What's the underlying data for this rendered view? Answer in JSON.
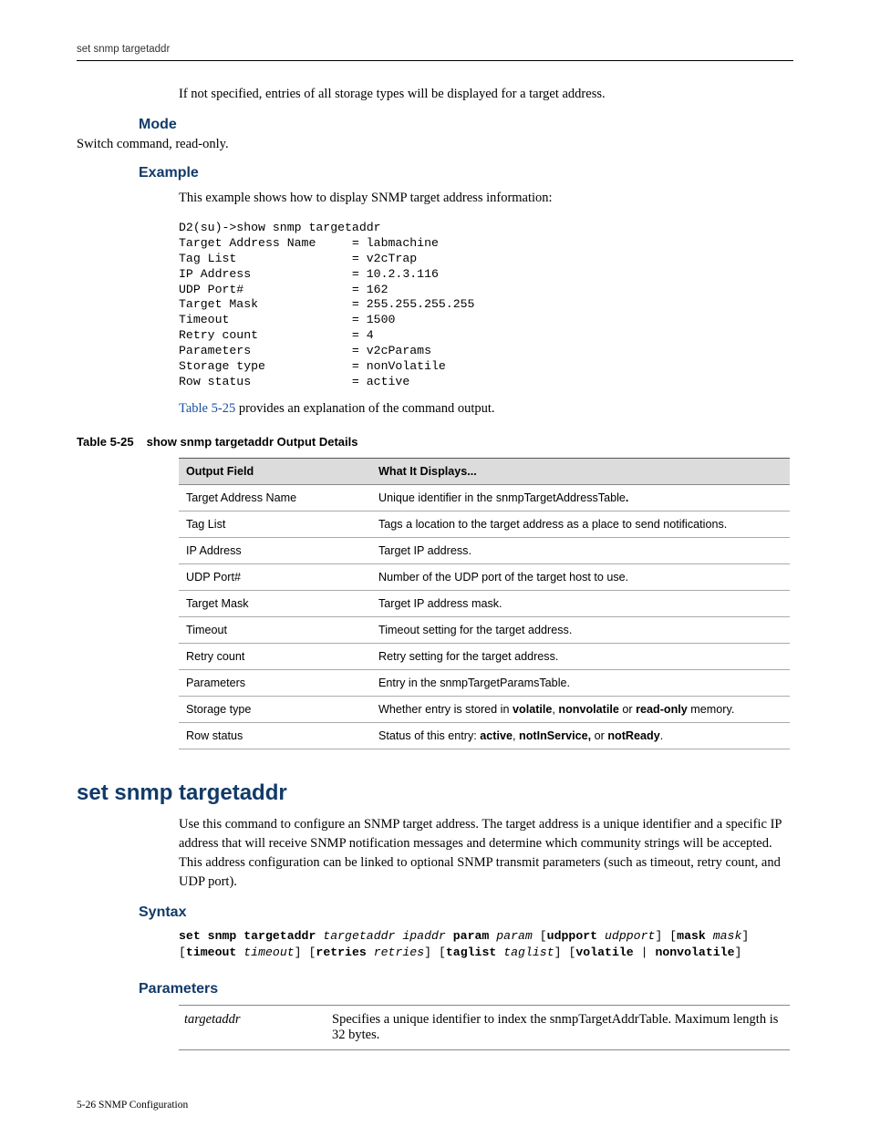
{
  "running_head": "set snmp targetaddr",
  "intro_note": "If not specified, entries of all storage types will be displayed for a target address.",
  "mode": {
    "heading": "Mode",
    "text": "Switch command, read-only."
  },
  "example": {
    "heading": "Example",
    "text": "This example shows how to display SNMP target address information:",
    "code": "D2(su)->show snmp targetaddr\nTarget Address Name     = labmachine\nTag List                = v2cTrap\nIP Address              = 10.2.3.116\nUDP Port#               = 162\nTarget Mask             = 255.255.255.255\nTimeout                 = 1500\nRetry count             = 4\nParameters              = v2cParams\nStorage type            = nonVolatile\nRow status              = active",
    "table_ref_link": "Table 5-25",
    "table_ref_rest": " provides an explanation of the command output."
  },
  "table525": {
    "caption_id": "Table 5-25",
    "caption_title": "show snmp targetaddr Output Details",
    "head_field": "Output Field",
    "head_desc": "What It Displays...",
    "rows": [
      {
        "f": "Target Address Name",
        "d_pre": "Unique identifier in the snmpTargetAddressTable",
        "d_bold1": ".",
        "d_mid": "",
        "d_bold2": "",
        "d_mid2": "",
        "d_bold3": "",
        "d_post": ""
      },
      {
        "f": "Tag List",
        "d_pre": "Tags a location to the target address as a place to send notifications.",
        "d_bold1": "",
        "d_mid": "",
        "d_bold2": "",
        "d_mid2": "",
        "d_bold3": "",
        "d_post": ""
      },
      {
        "f": "IP Address",
        "d_pre": "Target IP address.",
        "d_bold1": "",
        "d_mid": "",
        "d_bold2": "",
        "d_mid2": "",
        "d_bold3": "",
        "d_post": ""
      },
      {
        "f": "UDP Port#",
        "d_pre": "Number of the UDP port of the target host to use.",
        "d_bold1": "",
        "d_mid": "",
        "d_bold2": "",
        "d_mid2": "",
        "d_bold3": "",
        "d_post": ""
      },
      {
        "f": "Target Mask",
        "d_pre": "Target IP address mask.",
        "d_bold1": "",
        "d_mid": "",
        "d_bold2": "",
        "d_mid2": "",
        "d_bold3": "",
        "d_post": ""
      },
      {
        "f": "Timeout",
        "d_pre": "Timeout setting for the target address.",
        "d_bold1": "",
        "d_mid": "",
        "d_bold2": "",
        "d_mid2": "",
        "d_bold3": "",
        "d_post": ""
      },
      {
        "f": "Retry count",
        "d_pre": "Retry setting for the target address.",
        "d_bold1": "",
        "d_mid": "",
        "d_bold2": "",
        "d_mid2": "",
        "d_bold3": "",
        "d_post": ""
      },
      {
        "f": "Parameters",
        "d_pre": "Entry in the snmpTargetParamsTable.",
        "d_bold1": "",
        "d_mid": "",
        "d_bold2": "",
        "d_mid2": "",
        "d_bold3": "",
        "d_post": ""
      },
      {
        "f": "Storage type",
        "d_pre": "Whether entry is stored in ",
        "d_bold1": "volatile",
        "d_mid": ", ",
        "d_bold2": "nonvolatile",
        "d_mid2": " or ",
        "d_bold3": "read-only",
        "d_post": " memory."
      },
      {
        "f": "Row status",
        "d_pre": "Status of this entry: ",
        "d_bold1": "active",
        "d_mid": ", ",
        "d_bold2": "notInService,",
        "d_mid2": " or ",
        "d_bold3": "notReady",
        "d_post": "."
      }
    ]
  },
  "command": {
    "title": "set snmp targetaddr",
    "desc": "Use this command to configure an SNMP target address. The target address is a unique identifier and a specific IP address that will receive SNMP notification messages and determine which community strings will be accepted. This address configuration can be linked to optional SNMP transmit parameters (such as timeout, retry count, and UDP port)."
  },
  "syntax": {
    "heading": "Syntax",
    "kw1": "set snmp targetaddr",
    "ar1": "targetaddr ipaddr",
    "kw2": "param",
    "ar2": "param",
    "kw3": "udpport",
    "ar3": "udpport",
    "kw4": "mask",
    "ar4": "mask",
    "kw5": "timeout",
    "ar5": "timeout",
    "kw6": "retries",
    "ar6": "retries",
    "kw7": "taglist",
    "ar7": "taglist",
    "kw8": "volatile",
    "kw9": "nonvolatile"
  },
  "parameters": {
    "heading": "Parameters",
    "rows": [
      {
        "name": "targetaddr",
        "desc": "Specifies a unique identifier to index the snmpTargetAddrTable. Maximum length is 32 bytes."
      }
    ]
  },
  "footer": "5-26   SNMP Configuration"
}
